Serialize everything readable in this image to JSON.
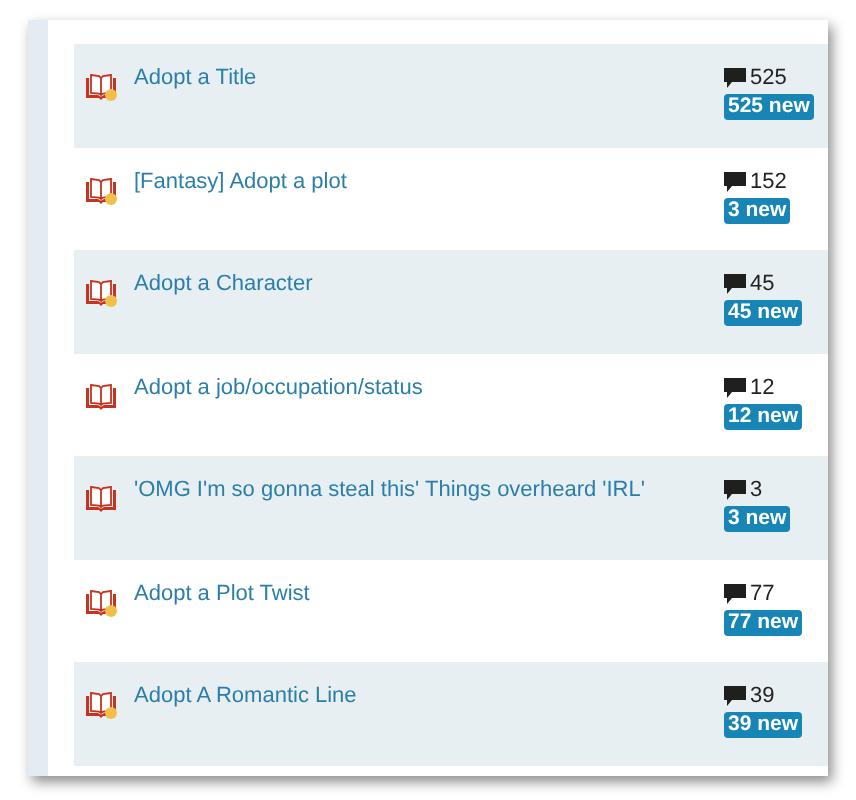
{
  "threads": [
    {
      "title": "Adopt a Title",
      "kind": "book-marked",
      "count": "525",
      "badge": "525 new"
    },
    {
      "title": "[Fantasy] Adopt a plot",
      "kind": "book-marked",
      "count": "152",
      "badge": "3 new"
    },
    {
      "title": "Adopt a Character",
      "kind": "book-marked",
      "count": "45",
      "badge": "45 new"
    },
    {
      "title": "Adopt a job/occupation/status",
      "kind": "book",
      "count": "12",
      "badge": "12 new"
    },
    {
      "title": "'OMG I'm so gonna steal this' Things overheard 'IRL'",
      "kind": "book",
      "count": "3",
      "badge": "3 new"
    },
    {
      "title": "Adopt a Plot Twist",
      "kind": "book-marked",
      "count": "77",
      "badge": "77 new"
    },
    {
      "title": "Adopt A Romantic Line",
      "kind": "book-marked",
      "count": "39",
      "badge": "39 new"
    }
  ]
}
